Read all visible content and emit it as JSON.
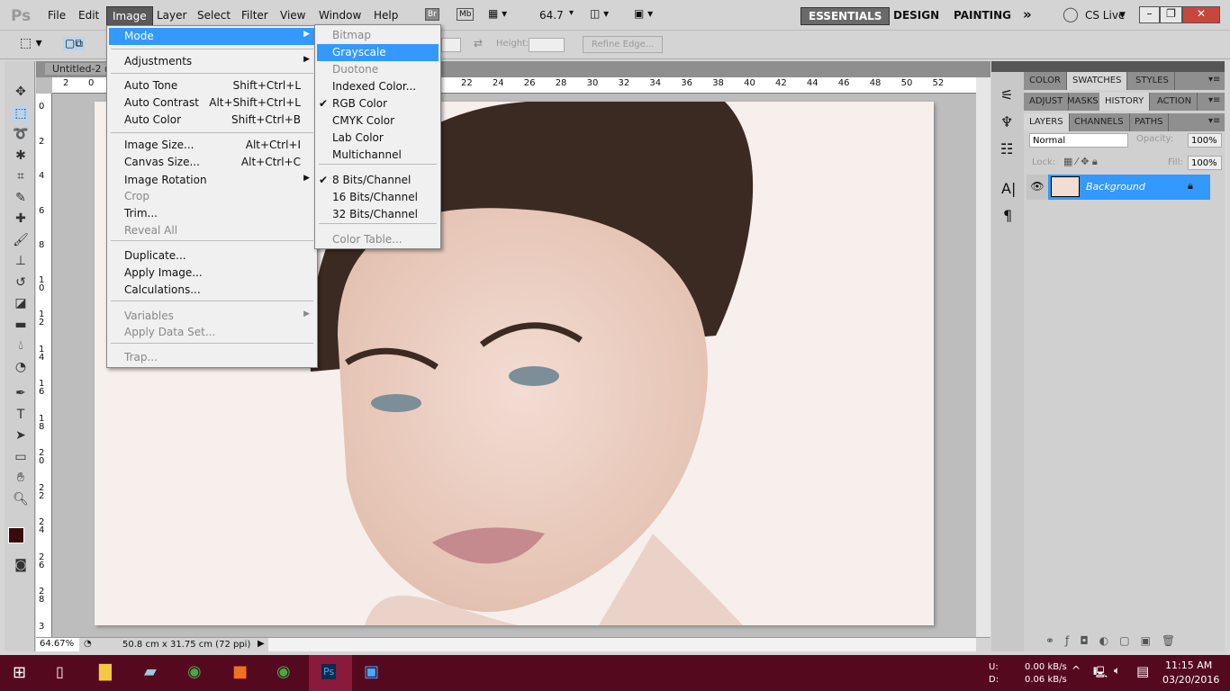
{
  "app": {
    "logo": "Ps"
  },
  "menubar": {
    "items": [
      "File",
      "Edit",
      "Image",
      "Layer",
      "Select",
      "Filter",
      "View",
      "Window",
      "Help"
    ],
    "br": "Br",
    "mb": "Mb",
    "zoom": "64.7",
    "workspaces": [
      "ESSENTIALS",
      "DESIGN",
      "PAINTING"
    ],
    "more": "»",
    "cslive": "CS Live"
  },
  "options": {
    "height_label": "Height:",
    "refine_edge": "Refine Edge..."
  },
  "document": {
    "tab": "Untitled-2 @",
    "zoom": "64.67%",
    "info": "50.8 cm x 31.75 cm (72 ppi)"
  },
  "ruler": {
    "h": [
      "2",
      "0",
      "22",
      "24",
      "26",
      "28",
      "30",
      "32",
      "34",
      "36",
      "38",
      "40",
      "42",
      "44",
      "46",
      "48",
      "50",
      "52"
    ],
    "v": [
      "0",
      "2",
      "4",
      "6",
      "8",
      "1 0",
      "1 2",
      "1 4",
      "1 6",
      "1 8",
      "2 0",
      "2 2",
      "2 4",
      "2 6",
      "2 8",
      "3"
    ]
  },
  "image_menu": {
    "items": [
      {
        "label": "Mode",
        "sub": true,
        "hl": true
      },
      {
        "label": "Adjustments",
        "sub": true
      },
      {
        "label": "Auto Tone",
        "sc": "Shift+Ctrl+L"
      },
      {
        "label": "Auto Contrast",
        "sc": "Alt+Shift+Ctrl+L"
      },
      {
        "label": "Auto Color",
        "sc": "Shift+Ctrl+B"
      },
      {
        "label": "Image Size...",
        "sc": "Alt+Ctrl+I"
      },
      {
        "label": "Canvas Size...",
        "sc": "Alt+Ctrl+C"
      },
      {
        "label": "Image Rotation",
        "sub": true
      },
      {
        "label": "Crop",
        "dis": true
      },
      {
        "label": "Trim..."
      },
      {
        "label": "Reveal All",
        "dis": true
      },
      {
        "label": "Duplicate..."
      },
      {
        "label": "Apply Image..."
      },
      {
        "label": "Calculations..."
      },
      {
        "label": "Variables",
        "sub": true,
        "dis": true
      },
      {
        "label": "Apply Data Set...",
        "dis": true
      },
      {
        "label": "Trap...",
        "dis": true
      }
    ]
  },
  "mode_menu": {
    "items": [
      {
        "label": "Bitmap",
        "dis": true
      },
      {
        "label": "Grayscale",
        "hl": true
      },
      {
        "label": "Duotone",
        "dis": true
      },
      {
        "label": "Indexed Color..."
      },
      {
        "label": "RGB Color",
        "chk": true
      },
      {
        "label": "CMYK Color"
      },
      {
        "label": "Lab Color"
      },
      {
        "label": "Multichannel"
      },
      {
        "label": "8 Bits/Channel",
        "chk": true
      },
      {
        "label": "16 Bits/Channel"
      },
      {
        "label": "32 Bits/Channel"
      },
      {
        "label": "Color Table...",
        "dis": true
      }
    ]
  },
  "panels": {
    "group1": [
      "COLOR",
      "SWATCHES",
      "STYLES"
    ],
    "group2": [
      "ADJUST",
      "MASKS",
      "HISTORY",
      "ACTION"
    ],
    "group3": [
      "LAYERS",
      "CHANNELS",
      "PATHS"
    ],
    "blend": "Normal",
    "opacity_label": "Opacity:",
    "opacity": "100%",
    "lock_label": "Lock:",
    "fill_label": "Fill:",
    "fill": "100%",
    "layer": "Background"
  },
  "taskbar": {
    "u_label": "U:",
    "d_label": "D:",
    "up": "0.00 kB/s",
    "down": "0.06 kB/s",
    "time": "11:15 AM",
    "date": "03/20/2016"
  },
  "colors": {
    "accent": "#3399ff",
    "taskbar": "#55091f",
    "foreground": "#3a0a0a"
  }
}
